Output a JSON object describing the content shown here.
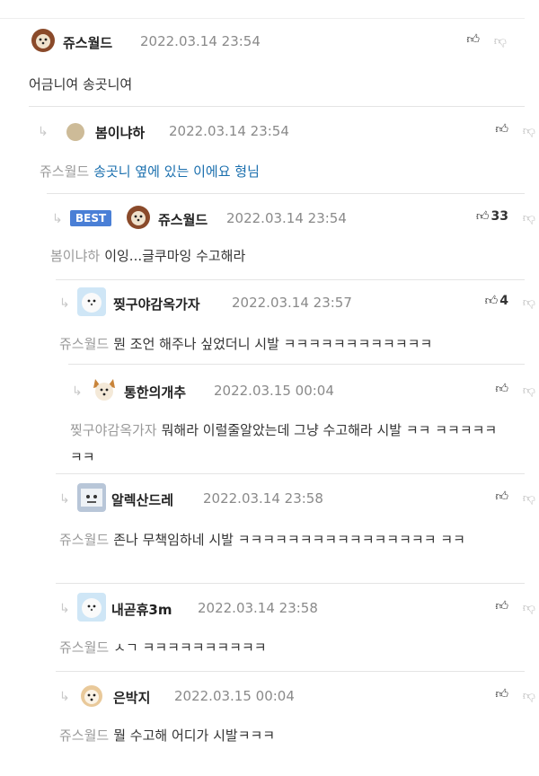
{
  "comments": [
    {
      "nick": "쥬스월드",
      "date": "2022.03.14 23:54",
      "mention": "",
      "text": "어금니여 송곳니여",
      "best": "",
      "likes": ""
    },
    {
      "nick": "봄이냐하",
      "date": "2022.03.14 23:54",
      "mention": "쥬스월드",
      "text": "송곳니 옆에 있는 이에요 형님",
      "best": "",
      "likes": ""
    },
    {
      "nick": "쥬스월드",
      "date": "2022.03.14 23:54",
      "mention": "봄이냐하",
      "text": "이잉...글쿠마잉 수고해라",
      "best": "BEST",
      "likes": "33"
    },
    {
      "nick": "찢구야감옥가자",
      "date": "2022.03.14 23:57",
      "mention": "쥬스월드",
      "text": "뭔 조언 해주나 싶었더니 시발 ㅋㅋㅋㅋㅋㅋㅋㅋㅋㅋㅋㅋ",
      "best": "",
      "likes": "4"
    },
    {
      "nick": "통한의개추",
      "date": "2022.03.15 00:04",
      "mention": "찢구야감옥가자",
      "text": "뭐해라 이럴줄알았는데 그냥 수고해라 시발 ㅋㅋ ㅋㅋㅋㅋㅋㅋㅋ",
      "best": "",
      "likes": ""
    },
    {
      "nick": "알렉산드레",
      "date": "2022.03.14 23:58",
      "mention": "쥬스월드",
      "text": "존나 무책임하네 시발 ㅋㅋㅋㅋㅋㅋㅋㅋㅋㅋㅋㅋㅋㅋㅋㅋ ㅋㅋ",
      "best": "",
      "likes": ""
    },
    {
      "nick": "내곧휴3m",
      "date": "2022.03.14 23:58",
      "mention": "쥬스월드",
      "text": "ㅅㄱ ㅋㅋㅋㅋㅋㅋㅋㅋㅋㅋ",
      "best": "",
      "likes": ""
    },
    {
      "nick": "은박지",
      "date": "2022.03.15 00:04",
      "mention": "쥬스월드",
      "text": "뭘 수고해 어디가 시발ㅋㅋㅋ",
      "best": "",
      "likes": ""
    }
  ]
}
